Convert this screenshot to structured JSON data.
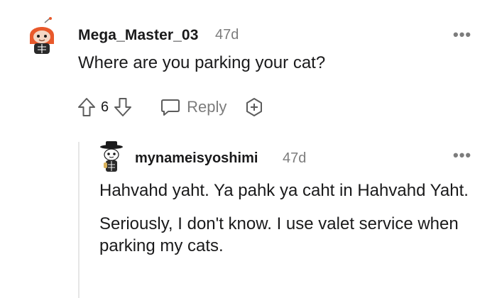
{
  "comments": [
    {
      "username": "Mega_Master_03",
      "age": "47d",
      "body": "Where are you parking your cat?",
      "upvotes": "6",
      "reply_label": "Reply"
    },
    {
      "username": "mynameisyoshimi",
      "age": "47d",
      "paragraphs": [
        "Hahvahd yaht. Ya pahk ya caht in Hahvahd Yaht.",
        "Seriously, I don't know. I use valet service when parking my cats."
      ]
    }
  ],
  "more_glyph": "•••",
  "icons": {
    "upvote": "arrow-up-icon",
    "downvote": "arrow-down-icon",
    "reply": "speech-bubble-icon",
    "award": "award-plus-icon",
    "more": "more-horizontal-icon"
  },
  "colors": {
    "text": "#1a1a1b",
    "meta": "#7c7c7c",
    "avatar_orange": "#e8592b"
  }
}
